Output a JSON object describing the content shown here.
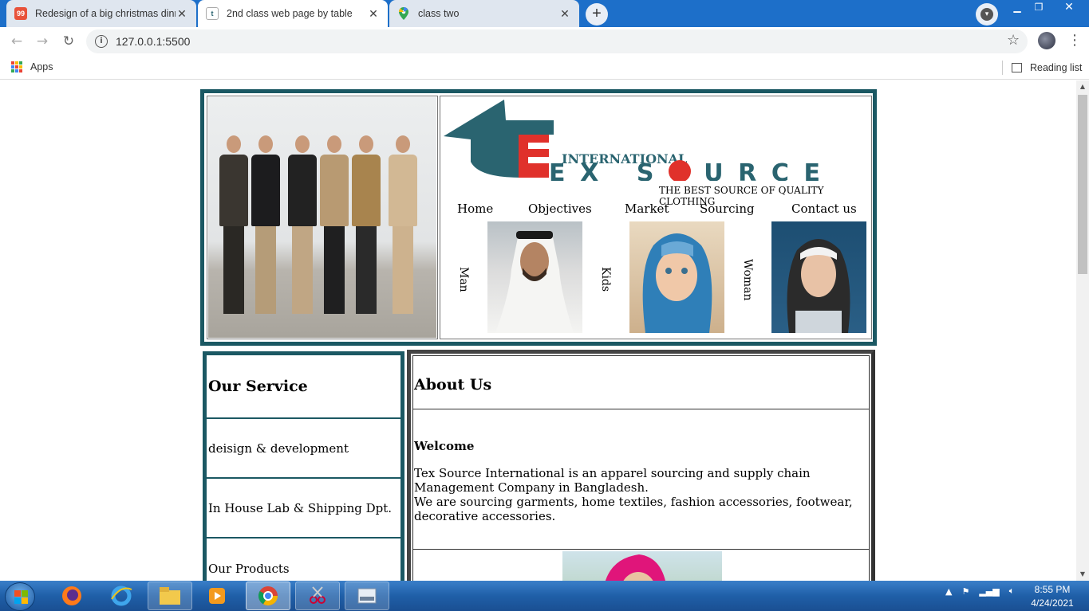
{
  "browser": {
    "tabs": [
      {
        "title": "Redesign of a big christmas dinn",
        "favicon": "99designs-icon",
        "active": false
      },
      {
        "title": "2nd class web page by table",
        "favicon": "texsource-icon",
        "active": true
      },
      {
        "title": "class two",
        "favicon": "maps-pin-icon",
        "active": false
      }
    ],
    "new_tab": "+",
    "url": "127.0.0.1:5500",
    "bookmarks": {
      "apps_label": "Apps",
      "reading_list_label": "Reading list"
    }
  },
  "page": {
    "brand": {
      "logo_line1": "INTERNATIONAL",
      "logo_line2": "EX SOURCE",
      "logo_letter": "t",
      "tagline": "THE BEST SOURCE OF QUALITY CLOTHING"
    },
    "nav": [
      "Home",
      "Objectives",
      "Market",
      "Sourcing",
      "Contact us"
    ],
    "categories": [
      "Man",
      "Kids",
      "Woman"
    ],
    "services": {
      "title": "Our Service",
      "items": [
        "deisign & development",
        "In House Lab & Shipping Dpt.",
        "Our Products"
      ]
    },
    "about": {
      "title": "About Us",
      "welcome": "Welcome",
      "line1": "Tex Source International is an apparel sourcing and supply chain Management Company in Bangladesh.",
      "line2": "We are sourcing garments, home textiles, fashion accessories, footwear, decorative accessories."
    }
  },
  "taskbar": {
    "time": "8:55 PM",
    "date": "4/24/2021"
  },
  "colors": {
    "header_border": "#1b5863",
    "about_border": "#444444",
    "logo_teal": "#2a6470",
    "logo_red": "#e0312b",
    "taskbar": "#1f5fa8"
  }
}
